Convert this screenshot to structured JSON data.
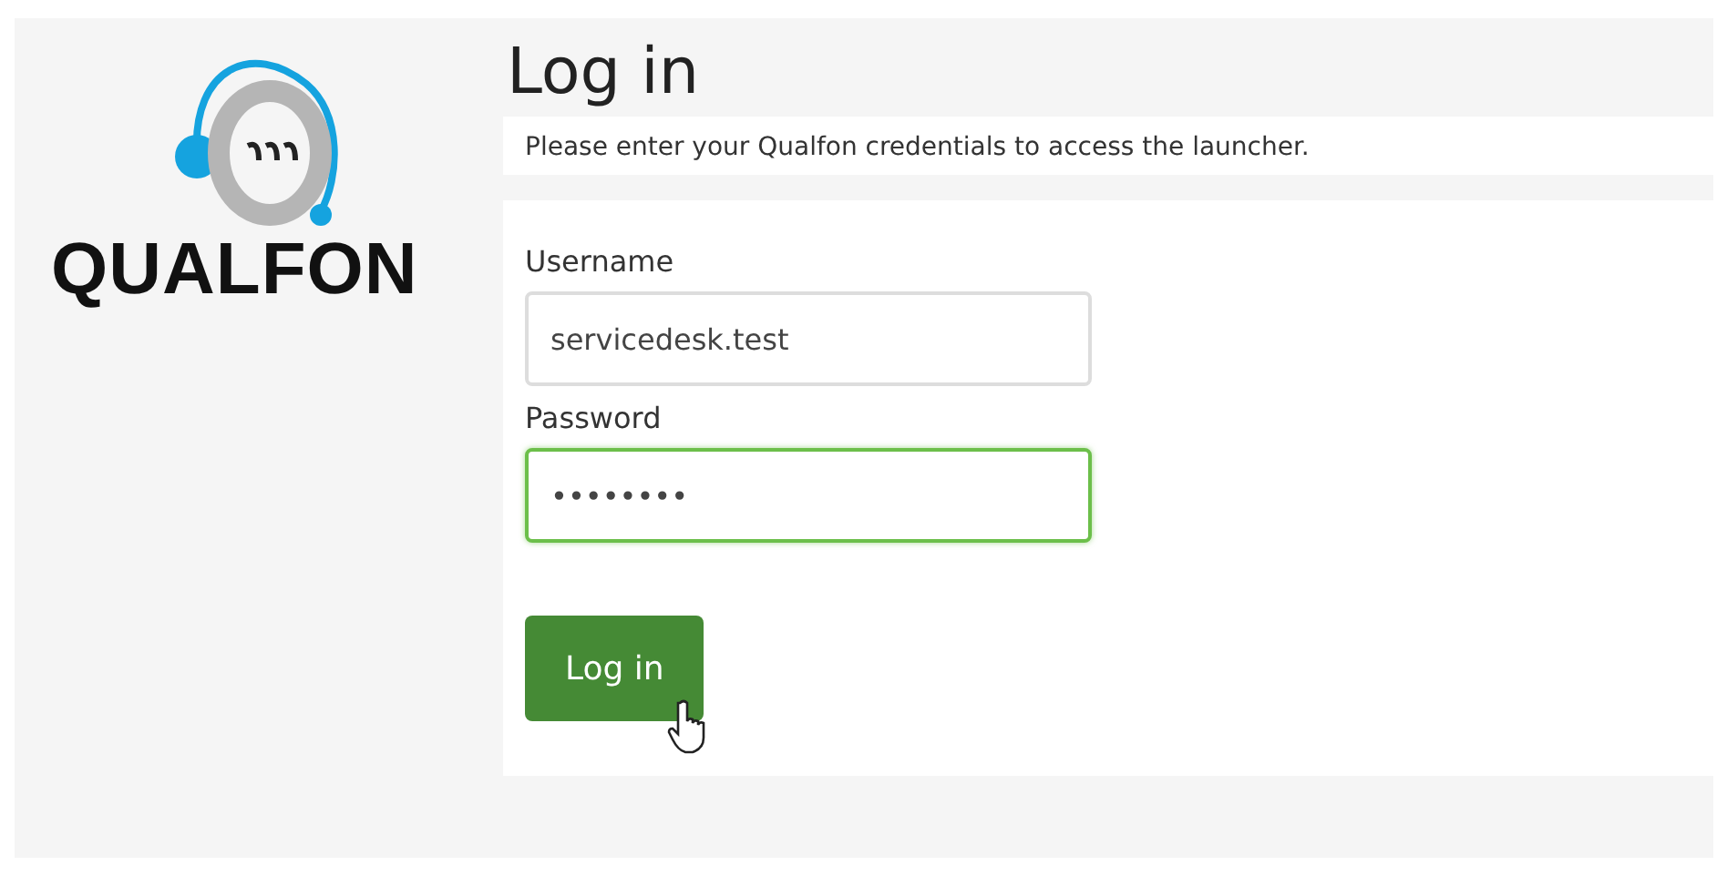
{
  "logo": {
    "wordmark": "QUALFON"
  },
  "title": "Log in",
  "intro": "Please enter your Qualfon credentials to access the launcher.",
  "fields": [
    {
      "label": "Username",
      "value": "servicedesk.test",
      "focused": false
    },
    {
      "label": "Password",
      "value": "••••••••",
      "focused": true
    }
  ],
  "submit": {
    "label": "Log in",
    "hovered": true
  }
}
